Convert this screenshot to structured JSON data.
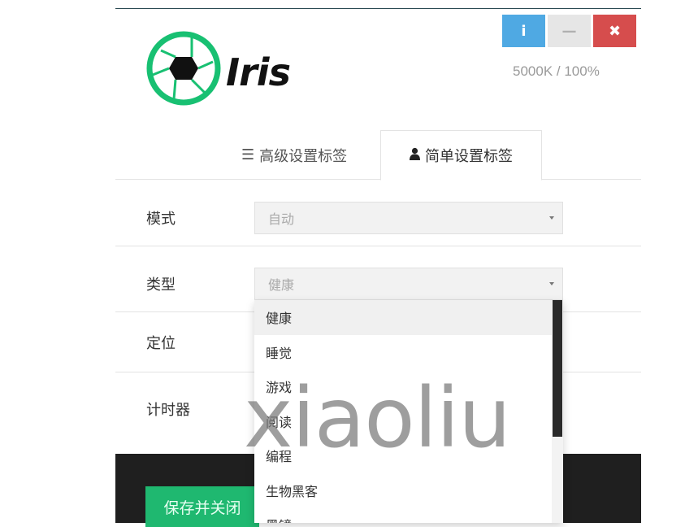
{
  "app": {
    "logo_text": "Iris",
    "status": "5000K / 100%",
    "window_buttons": {
      "info": "i",
      "minimize": "—",
      "close": "✖"
    }
  },
  "tabs": [
    {
      "icon": "menu-icon",
      "label": "高级设置标签"
    },
    {
      "icon": "user-icon",
      "label": "简单设置标签"
    }
  ],
  "rows": {
    "mode": {
      "label": "模式",
      "value": "自动"
    },
    "type": {
      "label": "类型",
      "value": "健康"
    },
    "location": {
      "label": "定位"
    },
    "timer": {
      "label": "计时器"
    }
  },
  "dropdown": {
    "options": [
      "健康",
      "睡觉",
      "游戏",
      "阅读",
      "编程",
      "生物黑客",
      "黑镜"
    ],
    "selected": "健康"
  },
  "footer": {
    "save_label": "保存并关闭"
  },
  "watermark": "xiaoliu",
  "colors": {
    "accent_green": "#1fb870",
    "info_blue": "#4fa9e3",
    "close_red": "#d64d4d",
    "logo_green": "#18c072"
  }
}
